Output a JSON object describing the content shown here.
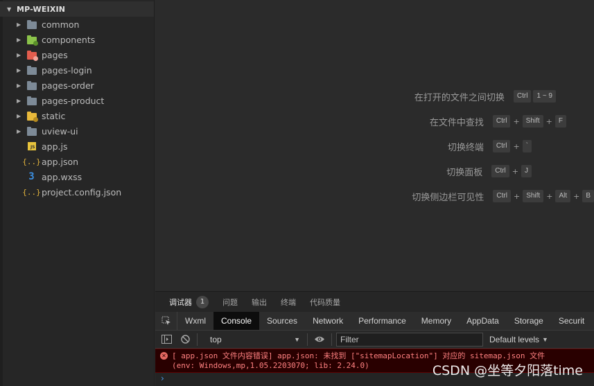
{
  "explorer": {
    "root": "MP-WEIXIN",
    "items": [
      {
        "name": "common",
        "type": "folder",
        "icon": "folder-icon"
      },
      {
        "name": "components",
        "type": "folder",
        "icon": "components-folder-icon"
      },
      {
        "name": "pages",
        "type": "folder",
        "icon": "pages-folder-icon"
      },
      {
        "name": "pages-login",
        "type": "folder",
        "icon": "folder-icon"
      },
      {
        "name": "pages-order",
        "type": "folder",
        "icon": "folder-icon"
      },
      {
        "name": "pages-product",
        "type": "folder",
        "icon": "folder-icon"
      },
      {
        "name": "static",
        "type": "folder",
        "icon": "static-folder-icon"
      },
      {
        "name": "uview-ui",
        "type": "folder",
        "icon": "folder-icon"
      },
      {
        "name": "app.js",
        "type": "file",
        "icon": "js-file-icon"
      },
      {
        "name": "app.json",
        "type": "file",
        "icon": "json-file-icon"
      },
      {
        "name": "app.wxss",
        "type": "file",
        "icon": "wxss-file-icon"
      },
      {
        "name": "project.config.json",
        "type": "file",
        "icon": "json-file-icon"
      }
    ]
  },
  "shortcuts": [
    {
      "label": "在打开的文件之间切换",
      "keys": [
        "Ctrl",
        "1 ~ 9"
      ],
      "joiner": ""
    },
    {
      "label": "在文件中查找",
      "keys": [
        "Ctrl",
        "Shift",
        "F"
      ],
      "joiner": "+"
    },
    {
      "label": "切换终端",
      "keys": [
        "Ctrl",
        "`"
      ],
      "joiner": "+"
    },
    {
      "label": "切换面板",
      "keys": [
        "Ctrl",
        "J"
      ],
      "joiner": "+"
    },
    {
      "label": "切换侧边栏可见性",
      "keys": [
        "Ctrl",
        "Shift",
        "Alt",
        "B"
      ],
      "joiner": "+"
    }
  ],
  "panel": {
    "tabs": [
      {
        "label": "调试器",
        "badge": "1",
        "active": true
      },
      {
        "label": "问题"
      },
      {
        "label": "输出"
      },
      {
        "label": "终端"
      },
      {
        "label": "代码质量"
      }
    ],
    "devtools_tabs": [
      "Wxml",
      "Console",
      "Sources",
      "Network",
      "Performance",
      "Memory",
      "AppData",
      "Storage",
      "Securit"
    ],
    "active_devtools_tab": "Console",
    "context": "top",
    "filter_placeholder": "Filter",
    "levels": "Default levels",
    "error": {
      "line1": "[ app.json 文件内容错误] app.json: 未找到 [\"sitemapLocation\"] 对应的 sitemap.json 文件",
      "line2": "(env: Windows,mp,1.05.2203070; lib: 2.24.0)"
    },
    "prompt": "›"
  },
  "watermark": "CSDN @坐等夕阳落time",
  "colors": {
    "editor_bg": "#2b2b2b",
    "sidebar_bg": "#262626",
    "error_bg": "#290000",
    "error_text": "#ff8080",
    "accent_blue": "#4e9ef0"
  }
}
